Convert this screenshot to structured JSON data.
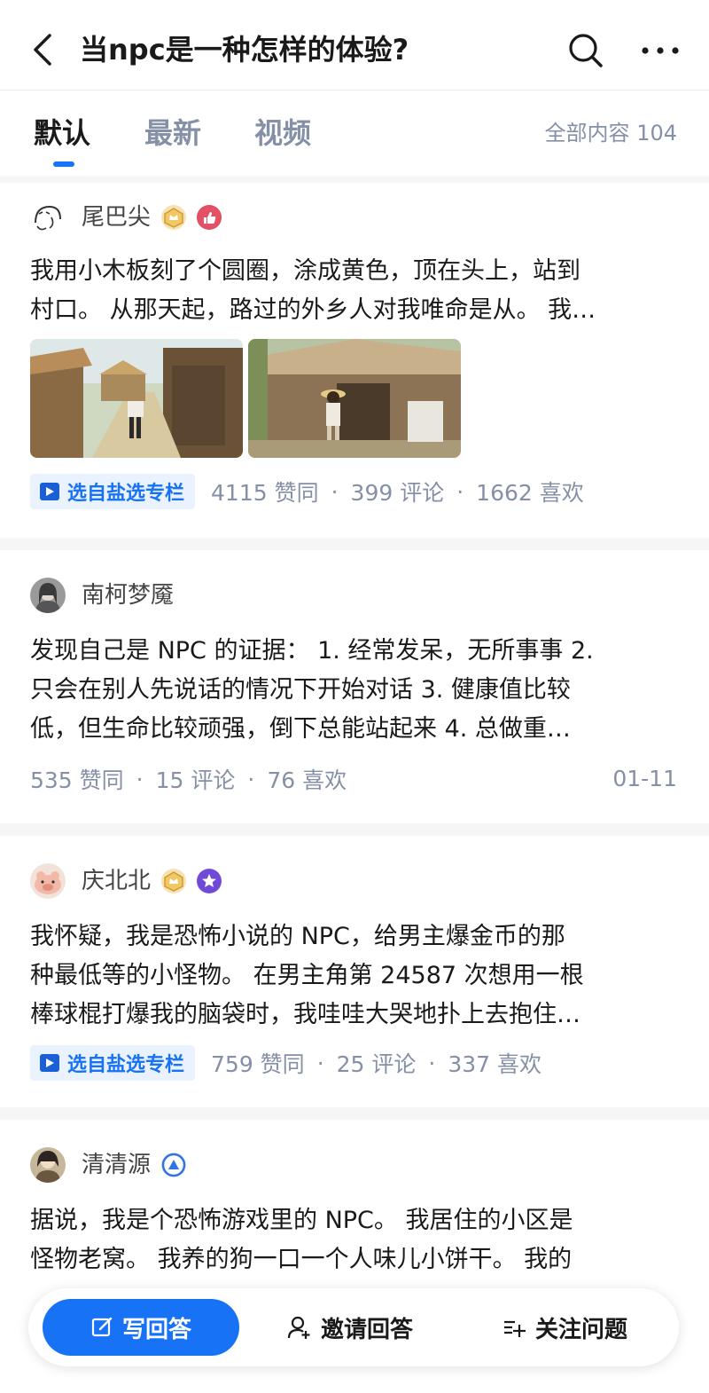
{
  "header": {
    "title": "当npc是一种怎样的体验?"
  },
  "tabs": [
    {
      "label": "默认",
      "active": true
    },
    {
      "label": "最新",
      "active": false
    },
    {
      "label": "视频",
      "active": false
    }
  ],
  "content_count": "全部内容 104",
  "answers": [
    {
      "author": "尾巴尖",
      "badges": [
        "crown-badge",
        "thumbs-up-badge"
      ],
      "lines": [
        "我用小木板刻了个圆圈，涂成黄色，顶在头上，站到",
        "村口。 从那天起，路过的外乡人对我唯命是从。 我…"
      ],
      "images": [
        "village-boy-image",
        "straw-hat-boy-image"
      ],
      "tag": "选自盐选专栏",
      "likes": "4115 赞同",
      "comments": "399 评论",
      "favorites": "1662 喜欢"
    },
    {
      "author": "南柯梦魇",
      "lines": [
        "发现自己是 NPC 的证据： 1. 经常发呆，无所事事 2.",
        "只会在别人先说话的情况下开始对话 3. 健康值比较",
        "低，但生命比较顽强，倒下总能站起来 4. 总做重…"
      ],
      "likes": "535 赞同",
      "comments": "15 评论",
      "favorites": "76 喜欢",
      "date": "01-11"
    },
    {
      "author": "庆北北",
      "badges": [
        "crown-badge",
        "star-badge"
      ],
      "lines": [
        "我怀疑，我是恐怖小说的 NPC，给男主爆金币的那",
        "种最低等的小怪物。 在男主角第 24587 次想用一根",
        "棒球棍打爆我的脑袋时，我哇哇大哭地扑上去抱住…"
      ],
      "tag": "选自盐选专栏",
      "likes": "759 赞同",
      "comments": "25 评论",
      "favorites": "337 喜欢"
    },
    {
      "author": "清清源",
      "badges": [
        "level-badge"
      ],
      "lines": [
        "据说，我是个恐怖游戏里的 NPC。 我居住的小区是",
        "怪物老窝。 我养的狗一口一个人味儿小饼干。 我的"
      ]
    }
  ],
  "bottom_bar": {
    "write": "写回答",
    "invite": "邀请回答",
    "follow": "关注问题"
  },
  "colors": {
    "accent": "#1772f6",
    "muted": "#8590a6"
  }
}
